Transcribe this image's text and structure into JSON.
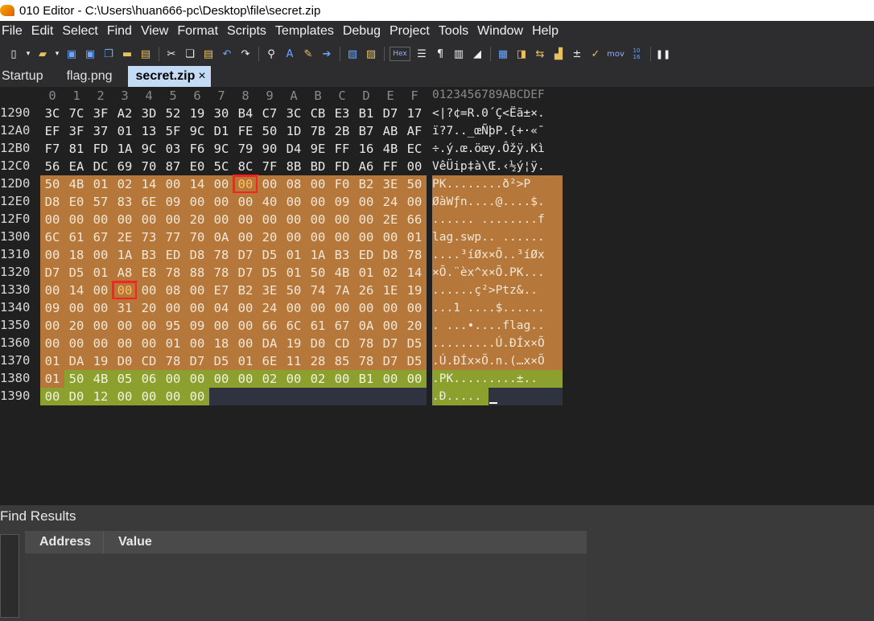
{
  "window": {
    "title": "010 Editor - C:\\Users\\huan666-pc\\Desktop\\file\\secret.zip"
  },
  "menu": [
    "File",
    "Edit",
    "Select",
    "Find",
    "View",
    "Format",
    "Scripts",
    "Templates",
    "Debug",
    "Project",
    "Tools",
    "Window",
    "Help"
  ],
  "toolbar": {
    "icons": [
      "new-file-icon",
      "open-icon",
      "save-icon",
      "save-all-icon",
      "copy-files-icon",
      "folder-icon",
      "folder-open-icon",
      "cut-icon",
      "copy-icon",
      "paste-icon",
      "undo-icon",
      "redo-icon",
      "find-icon",
      "replace-icon",
      "find-next-icon",
      "goto-icon",
      "script-icon",
      "template-icon",
      "hex-mode-icon",
      "text-mode-icon",
      "paragraph-icon",
      "columns-icon",
      "highlight-icon",
      "calculator-icon",
      "compare-icon",
      "swap-icon",
      "histogram-icon",
      "checksum-icon",
      "math-icon",
      "mov-icon",
      "base-convert-icon",
      "pause-icon"
    ],
    "hex_label": "Hex",
    "mov_label": "mov",
    "base_label": "10 16"
  },
  "tabs": [
    {
      "label": "Startup",
      "active": false
    },
    {
      "label": "flag.png",
      "active": false
    },
    {
      "label": "secret.zip",
      "active": true,
      "close": "×"
    }
  ],
  "hex": {
    "columns": [
      "0",
      "1",
      "2",
      "3",
      "4",
      "5",
      "6",
      "7",
      "8",
      "9",
      "A",
      "B",
      "C",
      "D",
      "E",
      "F"
    ],
    "ascii_header": "0123456789ABCDEF",
    "rows": [
      {
        "addr": "1290",
        "bytes": [
          "3C",
          "7C",
          "3F",
          "A2",
          "3D",
          "52",
          "19",
          "30",
          "B4",
          "C7",
          "3C",
          "CB",
          "E3",
          "B1",
          "D7",
          "17"
        ],
        "ascii": "<|?¢=R.0´Ç<Ëã±×."
      },
      {
        "addr": "12A0",
        "bytes": [
          "EF",
          "3F",
          "37",
          "01",
          "13",
          "5F",
          "9C",
          "D1",
          "FE",
          "50",
          "1D",
          "7B",
          "2B",
          "B7",
          "AB",
          "AF"
        ],
        "ascii": "ï?7.._œÑþP.{+·«¯"
      },
      {
        "addr": "12B0",
        "bytes": [
          "F7",
          "81",
          "FD",
          "1A",
          "9C",
          "03",
          "F6",
          "9C",
          "79",
          "90",
          "D4",
          "9E",
          "FF",
          "16",
          "4B",
          "EC"
        ],
        "ascii": "÷.ý.œ.öœy.Ôžÿ.Kì"
      },
      {
        "addr": "12C0",
        "bytes": [
          "56",
          "EA",
          "DC",
          "69",
          "70",
          "87",
          "E0",
          "5C",
          "8C",
          "7F",
          "8B",
          "BD",
          "FD",
          "A6",
          "FF",
          "00"
        ],
        "ascii": "VêÜip‡à\\Œ.‹½ý¦ÿ."
      },
      {
        "addr": "12D0",
        "bytes": [
          "50",
          "4B",
          "01",
          "02",
          "14",
          "00",
          "14",
          "00",
          "00",
          "00",
          "08",
          "00",
          "F0",
          "B2",
          "3E",
          "50"
        ],
        "ascii": "PK........ð²>P"
      },
      {
        "addr": "12E0",
        "bytes": [
          "D8",
          "E0",
          "57",
          "83",
          "6E",
          "09",
          "00",
          "00",
          "00",
          "40",
          "00",
          "00",
          "09",
          "00",
          "24",
          "00"
        ],
        "ascii": "ØàWƒn....@....$."
      },
      {
        "addr": "12F0",
        "bytes": [
          "00",
          "00",
          "00",
          "00",
          "00",
          "00",
          "20",
          "00",
          "00",
          "00",
          "00",
          "00",
          "00",
          "00",
          "2E",
          "66"
        ],
        "ascii": "...... ........f"
      },
      {
        "addr": "1300",
        "bytes": [
          "6C",
          "61",
          "67",
          "2E",
          "73",
          "77",
          "70",
          "0A",
          "00",
          "20",
          "00",
          "00",
          "00",
          "00",
          "00",
          "01"
        ],
        "ascii": "lag.swp.. ......"
      },
      {
        "addr": "1310",
        "bytes": [
          "00",
          "18",
          "00",
          "1A",
          "B3",
          "ED",
          "D8",
          "78",
          "D7",
          "D5",
          "01",
          "1A",
          "B3",
          "ED",
          "D8",
          "78"
        ],
        "ascii": "....³íØx×Õ..³íØx"
      },
      {
        "addr": "1320",
        "bytes": [
          "D7",
          "D5",
          "01",
          "A8",
          "E8",
          "78",
          "88",
          "78",
          "D7",
          "D5",
          "01",
          "50",
          "4B",
          "01",
          "02",
          "14"
        ],
        "ascii": "×Õ.¨èx^x×Õ.PK..."
      },
      {
        "addr": "1330",
        "bytes": [
          "00",
          "14",
          "00",
          "00",
          "00",
          "08",
          "00",
          "E7",
          "B2",
          "3E",
          "50",
          "74",
          "7A",
          "26",
          "1E",
          "19"
        ],
        "ascii": "......ç²>Ptz&.."
      },
      {
        "addr": "1340",
        "bytes": [
          "09",
          "00",
          "00",
          "31",
          "20",
          "00",
          "00",
          "04",
          "00",
          "24",
          "00",
          "00",
          "00",
          "00",
          "00",
          "00"
        ],
        "ascii": "...1 ....$......"
      },
      {
        "addr": "1350",
        "bytes": [
          "00",
          "20",
          "00",
          "00",
          "00",
          "95",
          "09",
          "00",
          "00",
          "66",
          "6C",
          "61",
          "67",
          "0A",
          "00",
          "20"
        ],
        "ascii": ". ...•....flag.."
      },
      {
        "addr": "1360",
        "bytes": [
          "00",
          "00",
          "00",
          "00",
          "00",
          "01",
          "00",
          "18",
          "00",
          "DA",
          "19",
          "D0",
          "CD",
          "78",
          "D7",
          "D5"
        ],
        "ascii": ".........Ú.ÐÍx×Õ"
      },
      {
        "addr": "1370",
        "bytes": [
          "01",
          "DA",
          "19",
          "D0",
          "CD",
          "78",
          "D7",
          "D5",
          "01",
          "6E",
          "11",
          "28",
          "85",
          "78",
          "D7",
          "D5"
        ],
        "ascii": ".Ú.ÐÍx×Õ.n.(…x×Õ"
      },
      {
        "addr": "1380",
        "bytes": [
          "01",
          "50",
          "4B",
          "05",
          "06",
          "00",
          "00",
          "00",
          "00",
          "02",
          "00",
          "02",
          "00",
          "B1",
          "00",
          "00"
        ],
        "ascii": ".PK.........±.."
      },
      {
        "addr": "1390",
        "bytes": [
          "00",
          "D0",
          "12",
          "00",
          "00",
          "00",
          "00"
        ],
        "ascii": ".Ð....."
      }
    ]
  },
  "find_results": {
    "title": "Find Results",
    "columns": {
      "address": "Address",
      "value": "Value"
    }
  },
  "colors": {
    "orange_region": "#b5773a",
    "green_region": "#8ba02d",
    "highlight_box": "#ff2020",
    "active_tab": "#c4dbf5"
  }
}
